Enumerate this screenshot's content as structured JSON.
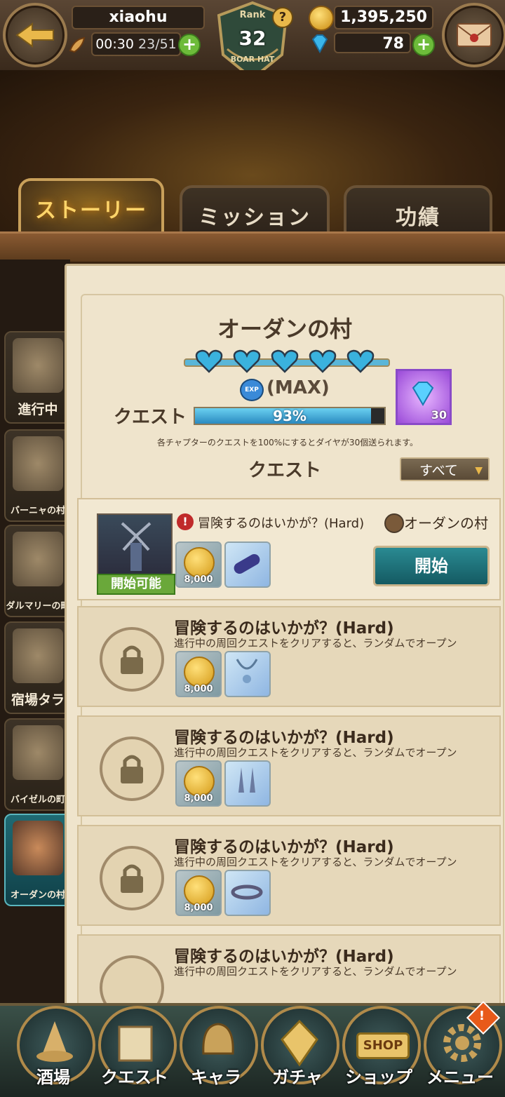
{
  "player": {
    "name": "xiaohu",
    "stamina_timer": "00:30",
    "stamina": "23/51",
    "rank_label": "Rank",
    "rank": "32",
    "crest": "BOAR HAT",
    "gold": "1,395,250",
    "gems": "78"
  },
  "tabs": [
    {
      "label": "ストーリー",
      "active": true
    },
    {
      "label": "ミッション"
    },
    {
      "label": "功績"
    }
  ],
  "sidebar": [
    {
      "label": "進行中"
    },
    {
      "label": "バーニャの村"
    },
    {
      "label": "ダルマリーの町"
    },
    {
      "label": "宿場タラ"
    },
    {
      "label": "バイゼルの町"
    },
    {
      "label": "オーダンの村",
      "active": true
    }
  ],
  "chapter": {
    "title": "オーダンの村",
    "exp_badge": "EXP",
    "level": "(MAX)",
    "progress_label": "クエスト",
    "progress_text": "93%",
    "progress": 0.93,
    "reward_count": "30",
    "note": "各チャプターのクエストを100%にするとダイヤが30個送られます。",
    "section_title": "クエスト",
    "filter": "すべて"
  },
  "active_quest": {
    "title": "冒険するのはいかが？(Hard)",
    "location": "オーダンの村",
    "status": "開始可能",
    "coin_amount": "8,000",
    "start_button": "開始"
  },
  "locked_quests": [
    {
      "title": "冒険するのはいかが？(Hard)",
      "desc": "進行中の周回クエストをクリアすると、ランダムでオープン",
      "coin_amount": "8,000"
    },
    {
      "title": "冒険するのはいかが？(Hard)",
      "desc": "進行中の周回クエストをクリアすると、ランダムでオープン",
      "coin_amount": "8,000"
    },
    {
      "title": "冒険するのはいかが？(Hard)",
      "desc": "進行中の周回クエストをクリアすると、ランダムでオープン",
      "coin_amount": "8,000"
    },
    {
      "title": "冒険するのはいかが？(Hard)",
      "desc": "進行中の周回クエストをクリアすると、ランダムでオープン"
    }
  ],
  "bottom_nav": [
    {
      "label": "酒場"
    },
    {
      "label": "クエスト"
    },
    {
      "label": "キャラ"
    },
    {
      "label": "ガチャ"
    },
    {
      "label": "ショップ"
    },
    {
      "label": "メニュー",
      "badge": "!"
    }
  ],
  "shop_sign": "SHOP",
  "colors": {
    "accent": "#1f6a73",
    "progress": "#3aa6d8",
    "gold": "#ffd56a"
  }
}
